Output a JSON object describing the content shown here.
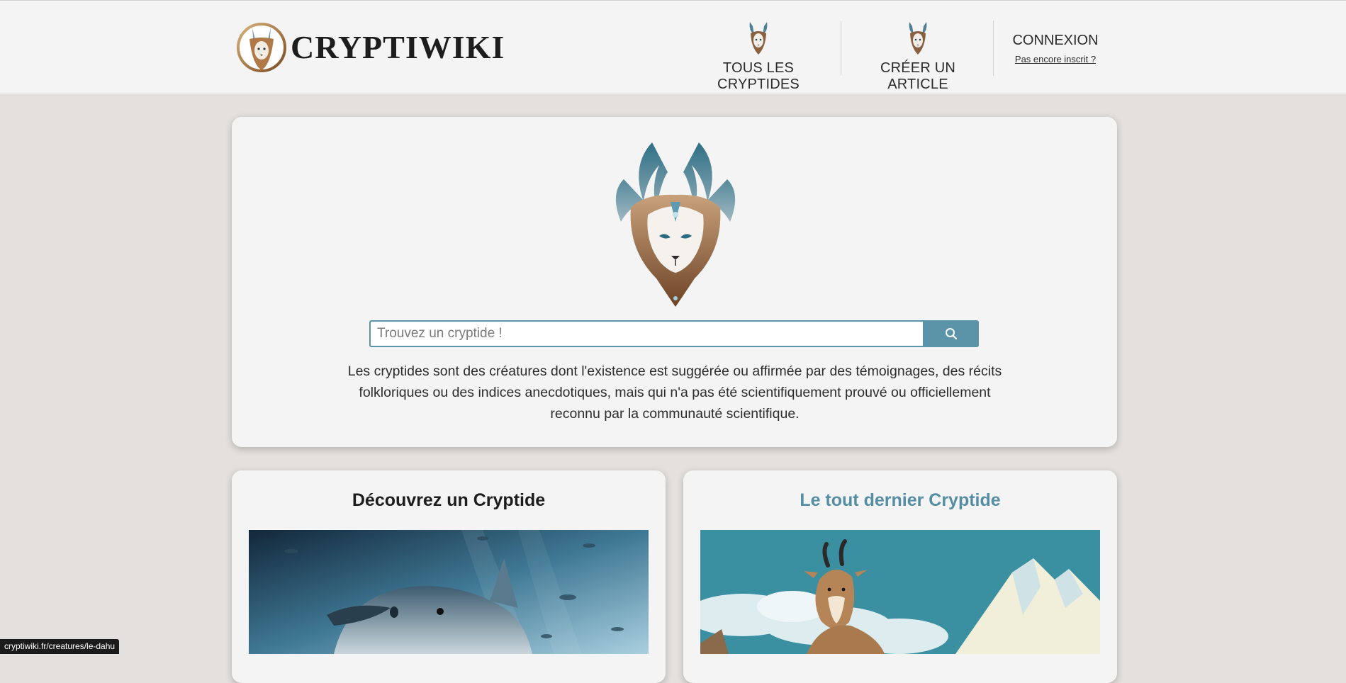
{
  "header": {
    "logo_text": "CRYPTIWIKI",
    "nav": {
      "all_cryptids": "TOUS LES CRYPTIDES",
      "create_article": "CRÉER UN ARTICLE"
    },
    "login": {
      "label": "CONNEXION",
      "signup": "Pas encore inscrit ?"
    }
  },
  "hero": {
    "search_placeholder": "Trouvez un cryptide !",
    "description": "Les cryptides sont des créatures dont l'existence est suggérée ou affirmée par des témoignages, des récits folkloriques ou des indices anecdotiques, mais qui n'a pas été scientifiquement prouvé ou officiellement reconnu par la communauté scientifique."
  },
  "cards": {
    "discover_title": "Découvrez un Cryptide",
    "latest_title": "Le tout dernier Cryptide"
  },
  "status_bar": {
    "url": "cryptiwiki.fr/creatures/le-dahu"
  },
  "colors": {
    "accent": "#5b94a8",
    "page_bg": "#e3e0dd",
    "card_bg": "#f4f4f4"
  }
}
